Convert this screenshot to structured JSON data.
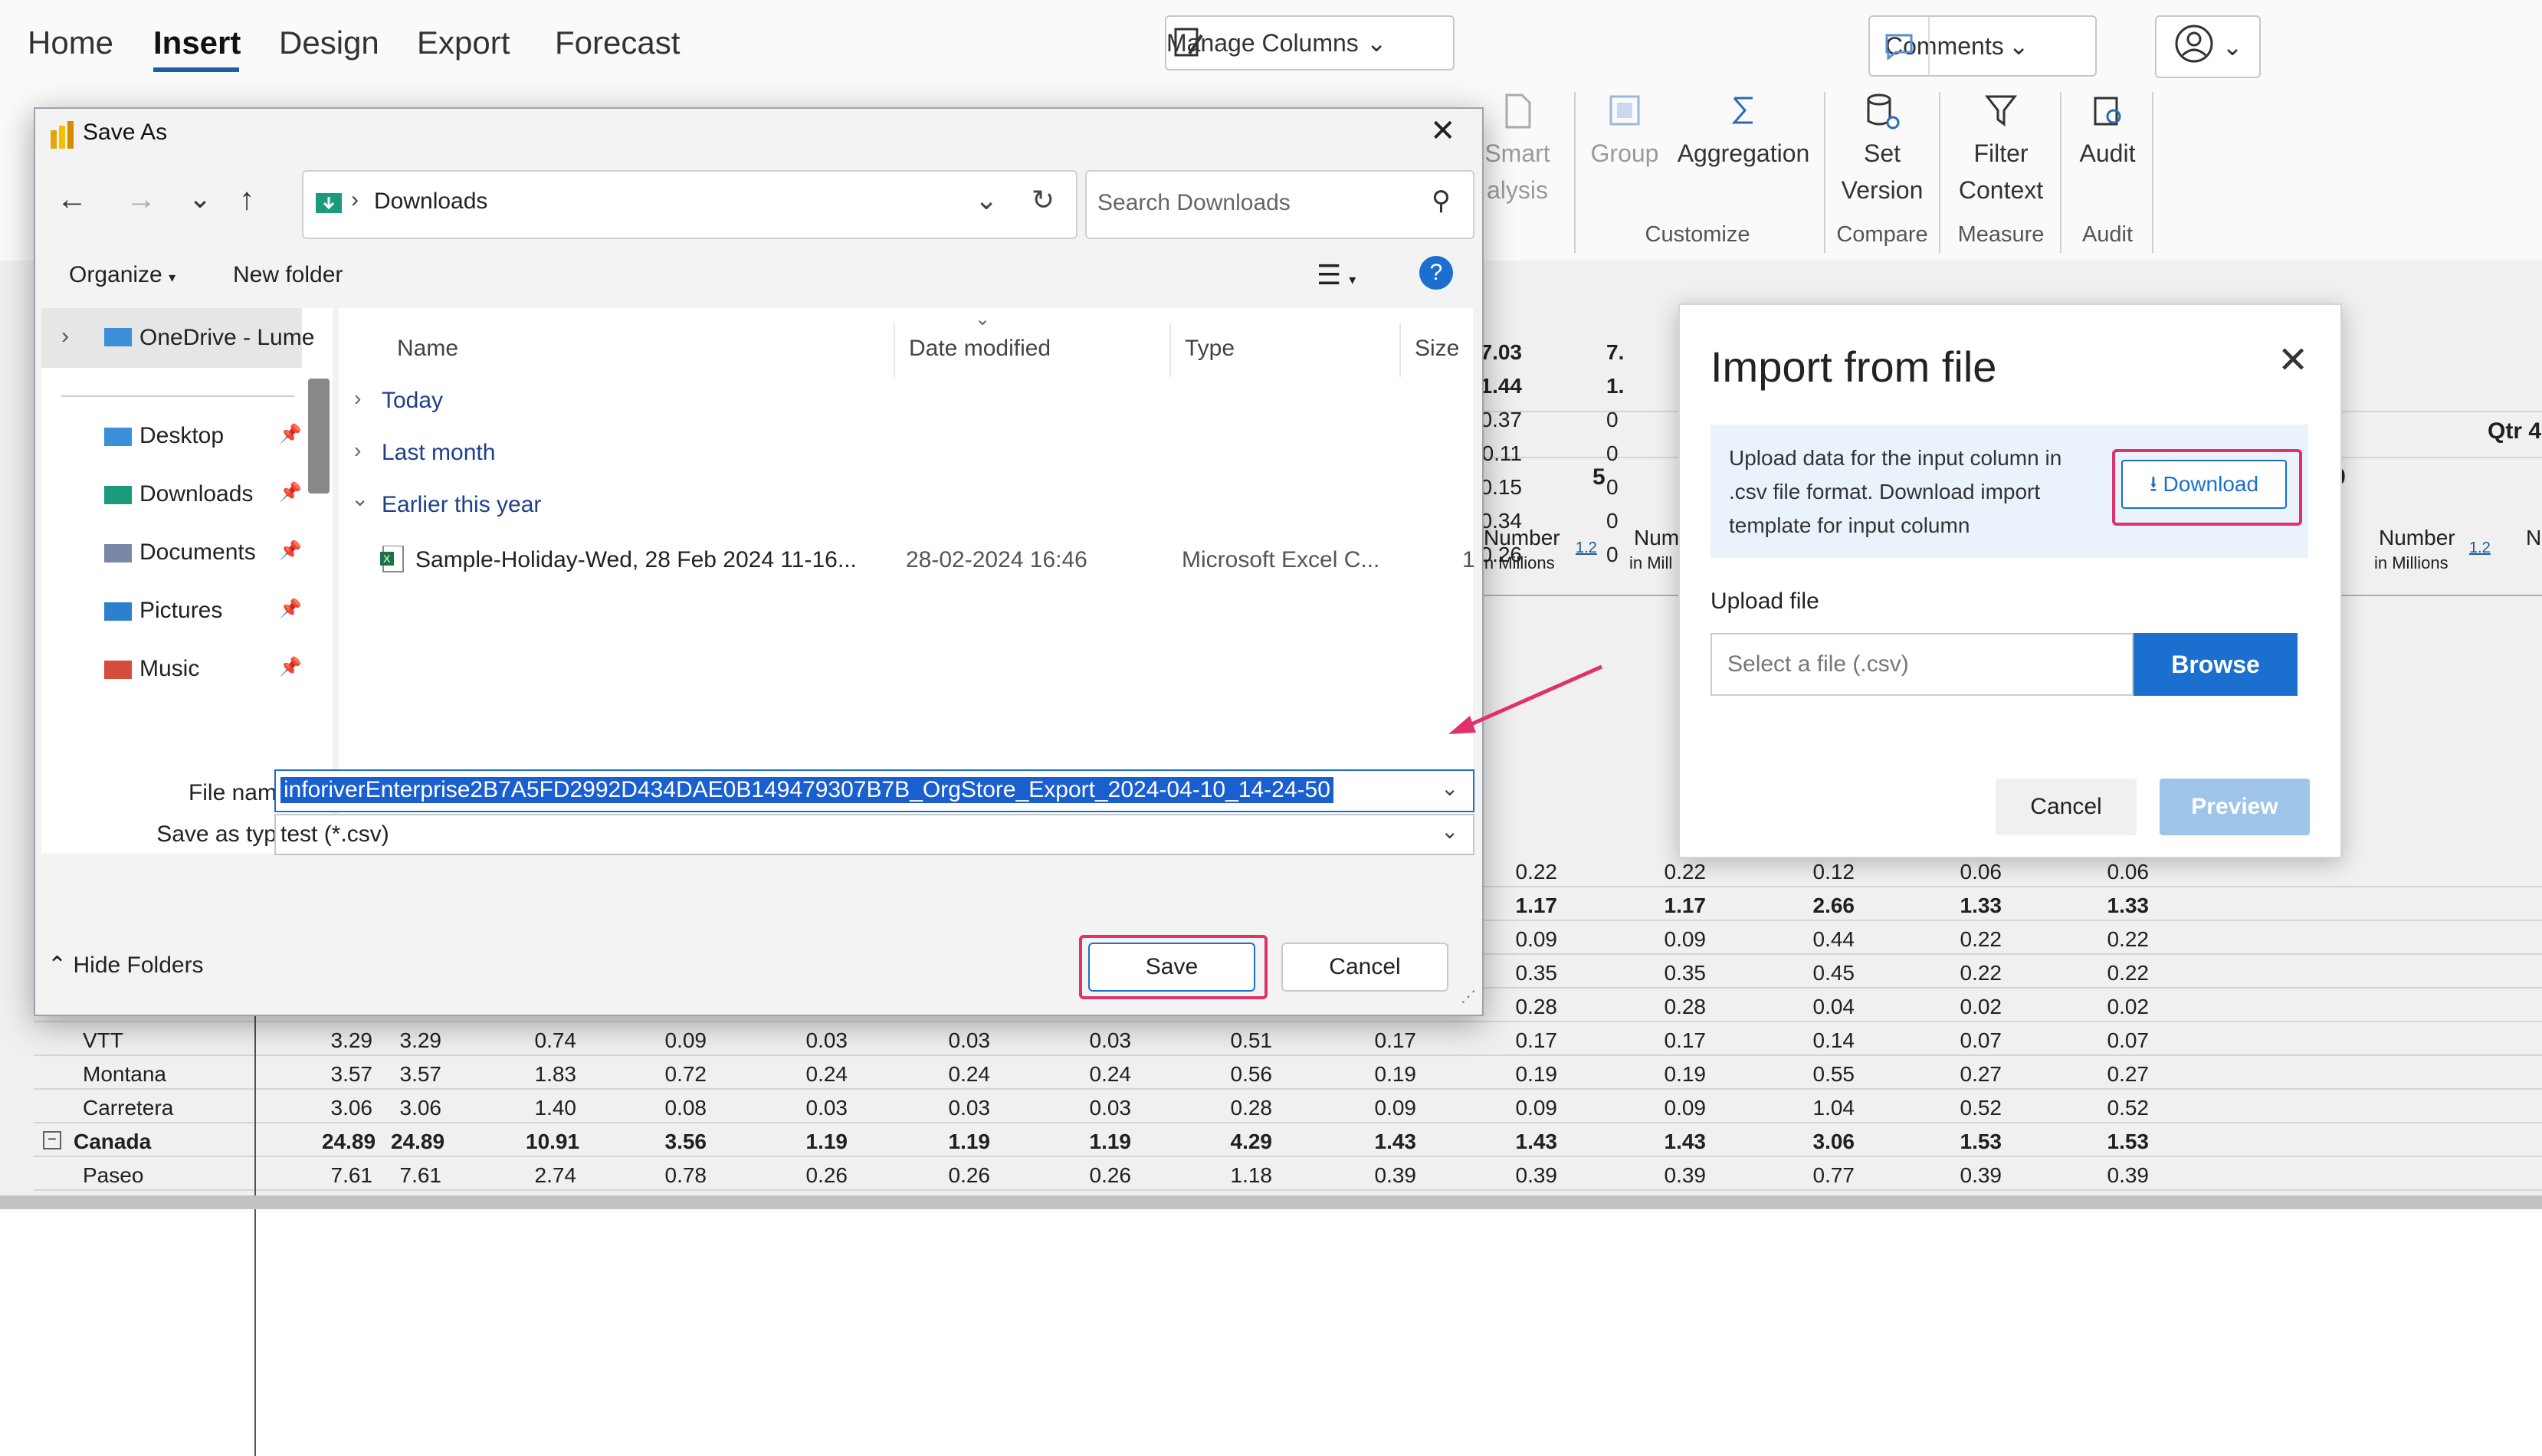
{
  "ribbon": {
    "menu": [
      "Home",
      "Insert",
      "Design",
      "Export",
      "Forecast"
    ],
    "active_menu": "Insert",
    "manage_columns": "Manage Columns",
    "comments": "Comments",
    "smart": "Smart",
    "analysis": "alysis",
    "group": "Group",
    "aggregation": "Aggregation",
    "set_version_1": "Set",
    "set_version_2": "Version",
    "filter_context_1": "Filter",
    "filter_context_2": "Context",
    "audit": "Audit",
    "captions": {
      "customize": "Customize",
      "compare": "Compare",
      "measure": "Measure",
      "audit": "Audit"
    }
  },
  "table": {
    "header_qtr": "Qtr 4",
    "header_5": "5",
    "header_9": "9",
    "number_label": "Number",
    "in_millions": "in Millions",
    "num_trunc": "Num",
    "in_mill_trunc": "in Mill",
    "mini_badge": "1.2",
    "right_col_values": [
      "7.03",
      "1.44",
      "0.37",
      "0.11",
      "0.15",
      "0.34",
      "0.26"
    ],
    "right_col2": [
      "7.",
      "1.",
      "0",
      "0",
      "0",
      "0",
      "0"
    ],
    "rows": [
      {
        "label": "",
        "bold": false,
        "vals": [
          "",
          "",
          "",
          "",
          "",
          "",
          "",
          "",
          "0.22",
          "0.22",
          "0.22",
          "0.12",
          "0.06",
          "0.06"
        ]
      },
      {
        "label": "",
        "bold": true,
        "vals": [
          "",
          "",
          "",
          "",
          "",
          "",
          "",
          "",
          "1.17",
          "1.17",
          "1.17",
          "2.66",
          "1.33",
          "1.33"
        ]
      },
      {
        "label": "",
        "bold": false,
        "vals": [
          "",
          "",
          "",
          "",
          "",
          "",
          "",
          "",
          "0.09",
          "0.09",
          "0.09",
          "0.44",
          "0.22",
          "0.22"
        ]
      },
      {
        "label": "",
        "bold": false,
        "vals": [
          "",
          "",
          "",
          "",
          "",
          "",
          "",
          "",
          "0.35",
          "0.35",
          "0.35",
          "0.45",
          "0.22",
          "0.22"
        ]
      },
      {
        "label": "",
        "bold": false,
        "vals": [
          "",
          "",
          "",
          "",
          "",
          "",
          "",
          "",
          "0.28",
          "0.28",
          "0.28",
          "0.04",
          "0.02",
          "0.02"
        ]
      },
      {
        "label": "VTT",
        "bold": false,
        "vals": [
          "3.29",
          "3.29",
          "0.74",
          "0.09",
          "0.03",
          "0.03",
          "0.03",
          "0.51",
          "0.17",
          "0.17",
          "0.17",
          "0.14",
          "0.07",
          "0.07"
        ]
      },
      {
        "label": "Montana",
        "bold": false,
        "vals": [
          "3.57",
          "3.57",
          "1.83",
          "0.72",
          "0.24",
          "0.24",
          "0.24",
          "0.56",
          "0.19",
          "0.19",
          "0.19",
          "0.55",
          "0.27",
          "0.27"
        ]
      },
      {
        "label": "Carretera",
        "bold": false,
        "vals": [
          "3.06",
          "3.06",
          "1.40",
          "0.08",
          "0.03",
          "0.03",
          "0.03",
          "0.28",
          "0.09",
          "0.09",
          "0.09",
          "1.04",
          "0.52",
          "0.52"
        ]
      },
      {
        "label": "Canada",
        "bold": true,
        "vals": [
          "24.89",
          "24.89",
          "10.91",
          "3.56",
          "1.19",
          "1.19",
          "1.19",
          "4.29",
          "1.43",
          "1.43",
          "1.43",
          "3.06",
          "1.53",
          "1.53"
        ]
      },
      {
        "label": "Paseo",
        "bold": false,
        "vals": [
          "7.61",
          "7.61",
          "2.74",
          "0.78",
          "0.26",
          "0.26",
          "0.26",
          "1.18",
          "0.39",
          "0.39",
          "0.39",
          "0.77",
          "0.39",
          "0.39"
        ]
      }
    ]
  },
  "save_as": {
    "title": "Save As",
    "path": "Downloads",
    "search_placeholder": "Search Downloads",
    "organize": "Organize",
    "new_folder": "New folder",
    "nav": [
      "OneDrive - Lume",
      "Desktop",
      "Downloads",
      "Documents",
      "Pictures",
      "Music"
    ],
    "columns": [
      "Name",
      "Date modified",
      "Type",
      "Size"
    ],
    "groups": [
      "Today",
      "Last month",
      "Earlier this year"
    ],
    "file": {
      "name": "Sample-Holiday-Wed, 28 Feb 2024 11-16...",
      "date": "28-02-2024 16:46",
      "type": "Microsoft Excel C...",
      "size": "1"
    },
    "file_name_label": "File name:",
    "file_name_value": "inforiverEnterprise2B7A5FD2992D434DAE0B149479307B7B_OrgStore_Export_2024-04-10_14-24-50",
    "save_type_label": "Save as type:",
    "save_type_value": "test (*.csv)",
    "hide_folders": "Hide Folders",
    "save": "Save",
    "cancel": "Cancel"
  },
  "import": {
    "title": "Import from file",
    "info": "Upload data for the input column in .csv file format. Download import template for input column",
    "download": "Download",
    "upload_label": "Upload file",
    "file_placeholder": "Select a file (.csv)",
    "browse": "Browse",
    "cancel": "Cancel",
    "preview": "Preview"
  },
  "colors": {
    "accent": "#1a6fcf",
    "highlight": "#e0316a",
    "browse_bg": "#1a6fcf",
    "preview_bg": "#9fc4ea"
  }
}
